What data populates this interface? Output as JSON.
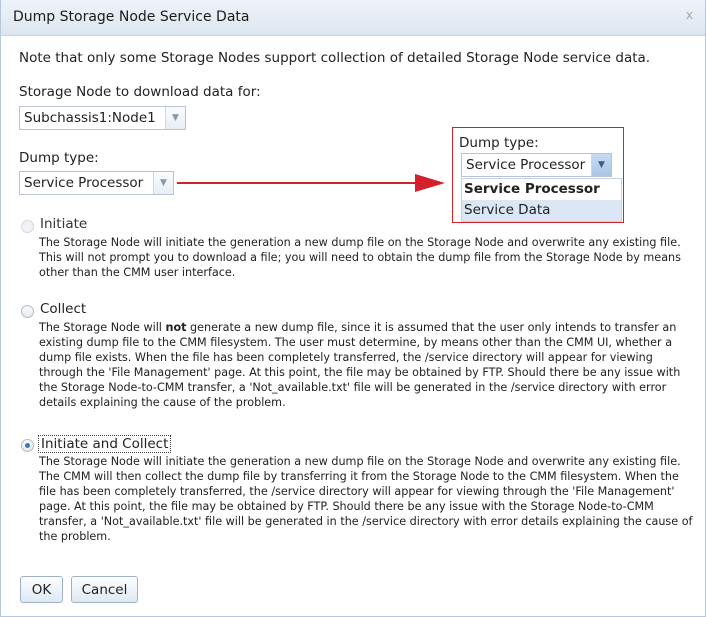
{
  "dialog": {
    "title": "Dump Storage Node Service Data",
    "close_glyph": "x"
  },
  "note": "Note that only some Storage Nodes support collection of detailed Storage Node service data.",
  "storage_node": {
    "label": "Storage Node to download data for:",
    "value": "Subchassis1:Node1"
  },
  "dump_type": {
    "label": "Dump type:",
    "value": "Service Processor"
  },
  "callout": {
    "label": "Dump type:",
    "value": "Service Processor",
    "options": [
      "Service Processor",
      "Service Data"
    ],
    "selected_index": 0,
    "highlighted_index": 1,
    "accent_color": "#d4202a"
  },
  "options": [
    {
      "label": "Initiate",
      "state": "disabled",
      "description": "The Storage Node will initiate the generation a new dump file on the Storage Node and overwrite any existing file. This will not prompt you to download a file; you will need to obtain the dump file from the Storage Node by means other than the CMM user interface."
    },
    {
      "label": "Collect",
      "state": "unselected",
      "desc_before": "The Storage Node will ",
      "desc_bold": "not",
      "desc_after": " generate a new dump file, since it is assumed that the user only intends to transfer an existing dump file to the CMM filesystem. The user must determine, by means other than the CMM UI, whether a dump file exists. When the file has been completely transferred, the /service directory will appear for viewing through the 'File Management' page. At this point, the file may be obtained by FTP. Should there be any issue with the Storage Node-to-CMM transfer, a 'Not_available.txt' file will be generated in the /service directory with error details explaining the cause of the problem."
    },
    {
      "label": "Initiate and Collect",
      "state": "selected",
      "description": "The Storage Node will initiate the generation a new dump file on the Storage Node and overwrite any existing file. The CMM will then collect the dump file by transferring it from the Storage Node to the CMM filesystem. When the file has been completely transferred, the /service directory will appear for viewing through the 'File Management' page. At this point, the file may be obtained by FTP. Should there be any issue with the Storage Node-to-CMM transfer, a 'Not_available.txt' file will be generated in the /service directory with error details explaining the cause of the problem."
    }
  ],
  "buttons": {
    "ok": "OK",
    "cancel": "Cancel"
  }
}
